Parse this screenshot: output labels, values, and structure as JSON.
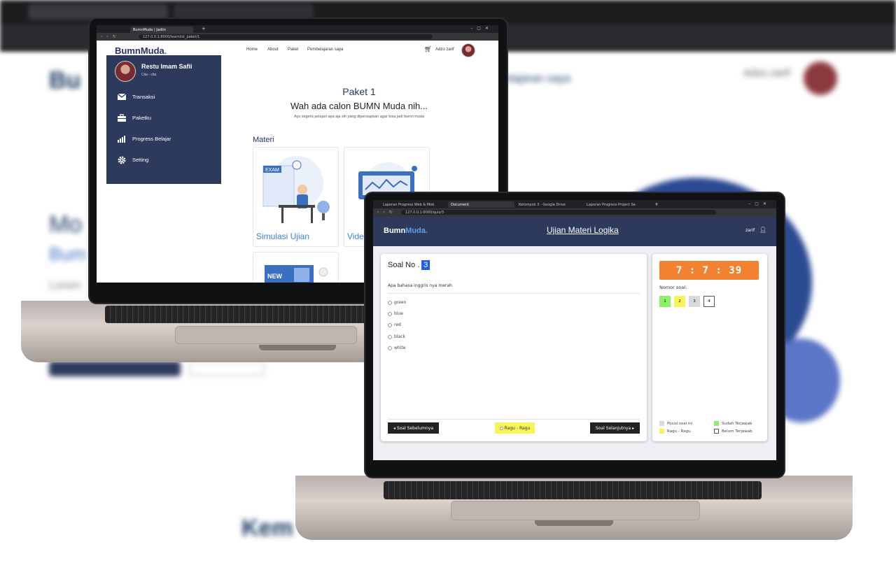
{
  "background": {
    "nav_user": "Adzo zarif",
    "headline_fragment": "Mo",
    "sub_fragment": "Bum",
    "body_fragment": "Lorem",
    "bottom_heading": "Kem",
    "nav_fragment": "elajaran saya"
  },
  "laptop1": {
    "browser": {
      "tab_title": "BumnMuda | Jadiin",
      "address": "127.0.0.1:8000/learnlist_paket/1"
    },
    "nav": {
      "logo_main": "BumnMuda",
      "logo_accent": ".",
      "links": [
        "Home",
        "About",
        "Paket",
        "Pembelajaran saya"
      ],
      "user_name": "Adzo zarif"
    },
    "sidebar": {
      "user_name": "Restu Imam Safii",
      "user_sub": "Cita - cita",
      "items": [
        {
          "label": "Transaksi",
          "icon": "mail-icon"
        },
        {
          "label": "Paketku",
          "icon": "briefcase-icon"
        },
        {
          "label": "Progress Belajar",
          "icon": "bar-chart-icon"
        },
        {
          "label": "Setting",
          "icon": "gear-icon"
        }
      ]
    },
    "main": {
      "title": "Paket 1",
      "headline": "Wah ada calon BUMN Muda nih...",
      "subtitle": "Ayo segera pelajari apa aja sih yang dipersiapkan agar bisa jadi bumn muda",
      "section_label": "Materi",
      "cards": [
        {
          "title": "Simulasi Ujian",
          "illustration": "EXAM"
        },
        {
          "title": "Vide",
          "illustration": ""
        },
        {
          "title": "",
          "illustration": "NEW"
        }
      ]
    }
  },
  "laptop2": {
    "browser": {
      "tabs": [
        "Laporan Progress Web & Mob",
        "Document",
        "Kelompok 3 - Google Drive",
        "Laporan Progress Project Se"
      ],
      "address": "127.0.0.1:8000/quiz/3"
    },
    "header": {
      "logo_main": "Bumn",
      "logo_accent": "Muda.",
      "title": "Ujian Materi Logika",
      "user": "zarif"
    },
    "question": {
      "label": "Soal No .",
      "number": "3",
      "text": "Apa bahasa inggris nya merah",
      "options": [
        "green",
        "blue",
        "red",
        "black",
        "white"
      ],
      "prev_button": "Soal Sebelumnya",
      "doubt_button": "Ragu - Ragu",
      "next_button": "Soal Selanjutnya"
    },
    "side": {
      "timer": "7 : 7 : 39",
      "numbers_label": "Nomor soal:",
      "numbers": [
        {
          "n": "1",
          "color": "#8ef064"
        },
        {
          "n": "2",
          "color": "#f7f358"
        },
        {
          "n": "3",
          "color": "#d9d9d9"
        },
        {
          "n": "4",
          "color": "#ffffff"
        }
      ],
      "legend": [
        {
          "label": "Posisi soal ini",
          "color": "#d9d9d9"
        },
        {
          "label": "Sudah Terjawab",
          "color": "#8ef064"
        },
        {
          "label": "Ragu - Ragu",
          "color": "#f7f358"
        },
        {
          "label": "Belum Terjawab",
          "color": "#ffffff"
        }
      ]
    }
  }
}
